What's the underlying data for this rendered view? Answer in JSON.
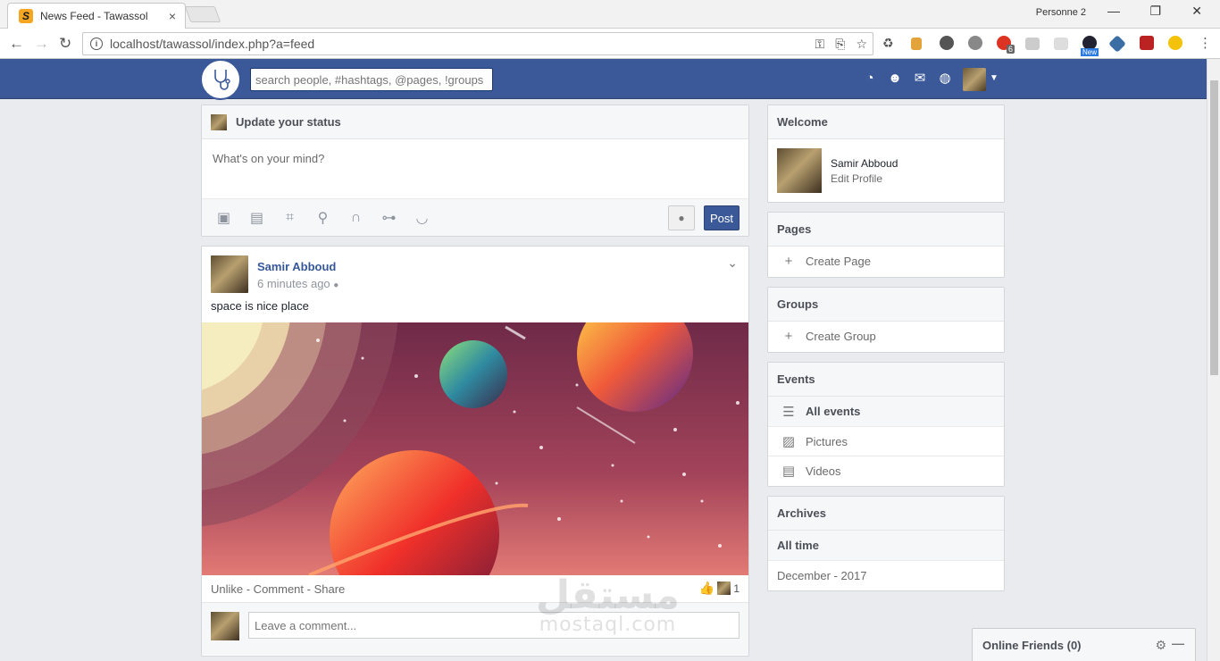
{
  "browser": {
    "tab_title": "News Feed - Tawassol",
    "tab_favicon": "S",
    "profile_label": "Personne 2",
    "url": "localhost/tawassol/index.php?a=feed",
    "extension_badge": "6",
    "new_badge": "New"
  },
  "header": {
    "search_placeholder": "search people, #hashtags, @pages, !groups"
  },
  "status_box": {
    "title": "Update your status",
    "placeholder": "What's on your mind?",
    "post_label": "Post",
    "tools": [
      "camera-icon",
      "video-icon",
      "map-icon",
      "location-pin-icon",
      "headphones-icon",
      "game-controller-icon",
      "bowl-icon"
    ]
  },
  "post": {
    "author": "Samir Abboud",
    "time": "6 minutes ago",
    "text": "space is nice place",
    "actions": "Unlike - Comment - Share",
    "like_count": "1",
    "comment_placeholder": "Leave a comment..."
  },
  "sidebar": {
    "welcome": {
      "title": "Welcome",
      "name": "Samir Abboud",
      "edit": "Edit Profile"
    },
    "pages": {
      "title": "Pages",
      "create": "Create Page"
    },
    "groups": {
      "title": "Groups",
      "create": "Create Group"
    },
    "events": {
      "title": "Events",
      "items": [
        "All events",
        "Pictures",
        "Videos"
      ]
    },
    "archives": {
      "title": "Archives",
      "items": [
        "All time",
        "December - 2017"
      ]
    }
  },
  "online_friends": {
    "label": "Online Friends (0)"
  },
  "watermark": {
    "arabic": "مستقل",
    "latin": "mostaql.com"
  },
  "colors": {
    "brand": "#3b5998",
    "link": "#365899",
    "background": "#e9ebee"
  }
}
